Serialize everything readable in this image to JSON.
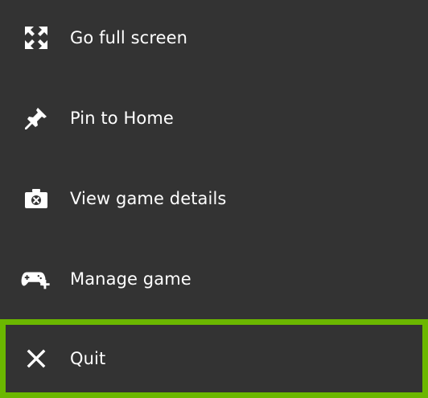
{
  "menu": {
    "items": [
      {
        "label": "Go full screen",
        "icon": "fullscreen-icon"
      },
      {
        "label": "Pin to Home",
        "icon": "pin-icon"
      },
      {
        "label": "View game details",
        "icon": "game-details-icon"
      },
      {
        "label": "Manage game",
        "icon": "manage-game-icon"
      },
      {
        "label": "Quit",
        "icon": "close-icon"
      }
    ],
    "focused_index": 4
  },
  "colors": {
    "background": "#333333",
    "text": "#ffffff",
    "focus_border": "#6bb700"
  }
}
